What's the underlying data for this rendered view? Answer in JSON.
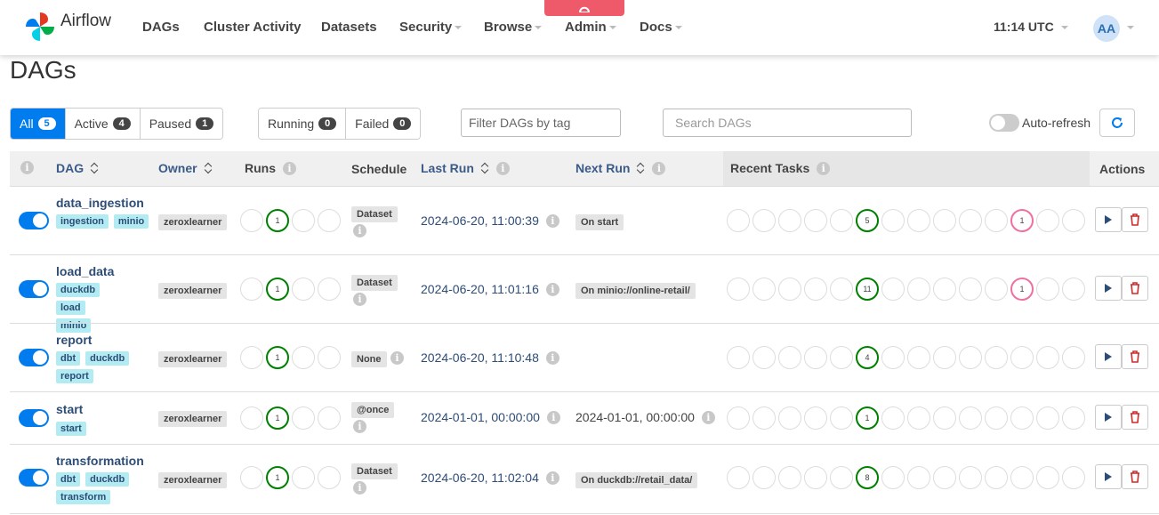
{
  "nav": {
    "brand": "Airflow",
    "items": [
      {
        "label": "DAGs",
        "dropdown": false
      },
      {
        "label": "Cluster Activity",
        "dropdown": false
      },
      {
        "label": "Datasets",
        "dropdown": false
      },
      {
        "label": "Security",
        "dropdown": true
      },
      {
        "label": "Browse",
        "dropdown": true
      },
      {
        "label": "Admin",
        "dropdown": true
      },
      {
        "label": "Docs",
        "dropdown": true
      }
    ],
    "time": "11:14 UTC",
    "avatar": "AA",
    "env_color": "#ef5a6b"
  },
  "page_title": "DAGs",
  "filters": {
    "status": [
      {
        "label": "All",
        "count": "5",
        "active": true
      },
      {
        "label": "Active",
        "count": "4"
      },
      {
        "label": "Paused",
        "count": "1"
      }
    ],
    "runs": [
      {
        "label": "Running",
        "count": "0"
      },
      {
        "label": "Failed",
        "count": "0"
      }
    ],
    "tag_placeholder": "Filter DAGs by tag",
    "search_placeholder": "Search DAGs",
    "autorefresh_label": "Auto-refresh"
  },
  "table": {
    "columns": {
      "dag": "DAG",
      "owner": "Owner",
      "runs": "Runs",
      "schedule": "Schedule",
      "last_run": "Last Run",
      "next_run": "Next Run",
      "recent_tasks": "Recent Tasks",
      "actions": "Actions"
    },
    "rows": [
      {
        "dag_id": "data_ingestion",
        "tags": [
          "ingestion",
          "minio"
        ],
        "owner": "zeroxlearner",
        "runs_success": "1",
        "schedule": "Dataset",
        "last_run": "2024-06-20, 11:00:39",
        "next_run": "On start",
        "tasks_success": "5",
        "tasks_failed": "1"
      },
      {
        "dag_id": "load_data",
        "tags": [
          "duckdb",
          "load",
          "minio"
        ],
        "owner": "zeroxlearner",
        "runs_success": "1",
        "schedule": "Dataset",
        "last_run": "2024-06-20, 11:01:16",
        "next_run": "On minio://online-retail/",
        "tasks_success": "11",
        "tasks_failed": "1"
      },
      {
        "dag_id": "report",
        "tags": [
          "dbt",
          "duckdb",
          "report"
        ],
        "owner": "zeroxlearner",
        "runs_success": "1",
        "schedule": "None",
        "last_run": "2024-06-20, 11:10:48",
        "next_run": "",
        "tasks_success": "4",
        "tasks_failed": ""
      },
      {
        "dag_id": "start",
        "tags": [
          "start"
        ],
        "owner": "zeroxlearner",
        "runs_success": "1",
        "schedule": "@once",
        "last_run": "2024-01-01, 00:00:00",
        "next_run": "2024-01-01, 00:00:00",
        "tasks_success": "1",
        "tasks_failed": ""
      },
      {
        "dag_id": "transformation",
        "tags": [
          "dbt",
          "duckdb",
          "transform"
        ],
        "owner": "zeroxlearner",
        "runs_success": "1",
        "schedule": "Dataset",
        "last_run": "2024-06-20, 11:02:04",
        "next_run": "On duckdb://retail_data/",
        "tasks_success": "8",
        "tasks_failed": ""
      }
    ]
  },
  "colors": {
    "accent": "#017cee",
    "success": "#008000",
    "failed": "#f06fa0",
    "delete": "#cc2b2b",
    "tag_bg": "#b2ebf2"
  }
}
